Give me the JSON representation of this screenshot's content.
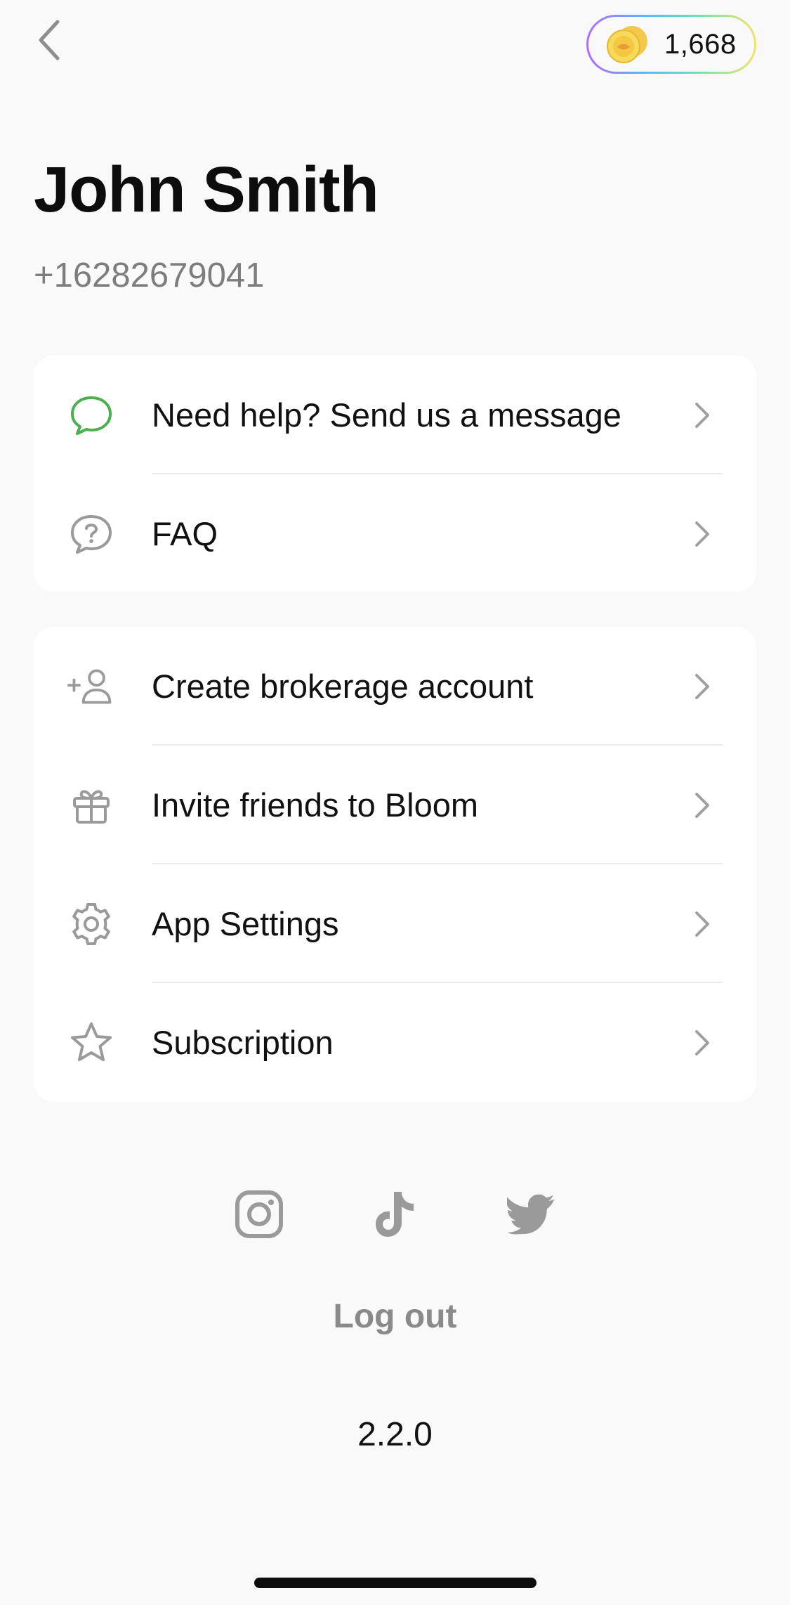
{
  "header": {
    "back_icon": "chevron-left-icon",
    "coins": "1,668",
    "coin_icon": "coin-stack-icon"
  },
  "profile": {
    "name": "John Smith",
    "phone": "+16282679041"
  },
  "support_items": [
    {
      "label": "Need help? Send us a message",
      "icon": "chat-bubble-icon",
      "icon_color": "#4caf50"
    },
    {
      "label": "FAQ",
      "icon": "question-bubble-icon",
      "icon_color": "#9a9a9a"
    }
  ],
  "account_items": [
    {
      "label": "Create brokerage account",
      "icon": "add-user-icon"
    },
    {
      "label": "Invite friends to Bloom",
      "icon": "gift-icon"
    },
    {
      "label": "App Settings",
      "icon": "gear-icon"
    },
    {
      "label": "Subscription",
      "icon": "star-icon"
    }
  ],
  "social": [
    "instagram-icon",
    "tiktok-icon",
    "twitter-icon"
  ],
  "logout_label": "Log out",
  "version": "2.2.0",
  "colors": {
    "background": "#f9f9f9",
    "card": "#ffffff",
    "accent_green": "#4caf50",
    "icon_gray": "#9a9a9a",
    "secondary_text": "#7d7d7d"
  }
}
